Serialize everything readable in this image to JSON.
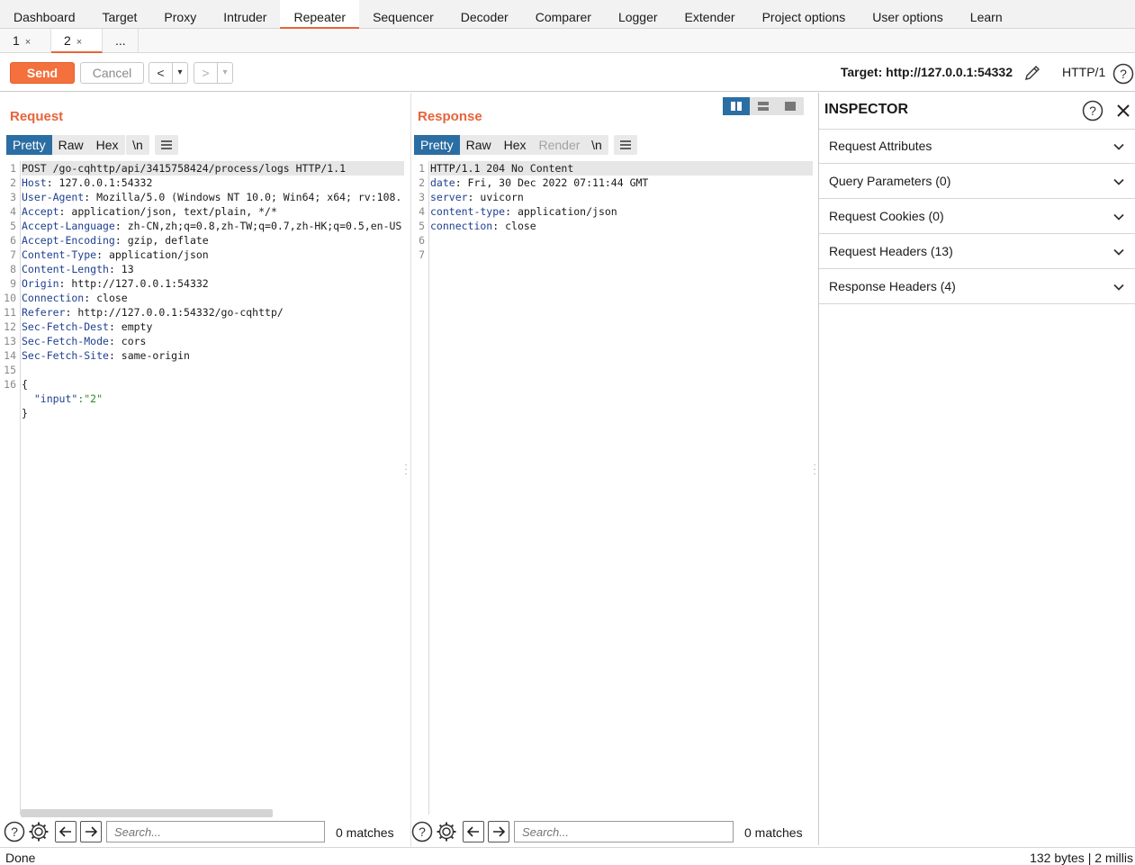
{
  "top_tabs": [
    "Dashboard",
    "Target",
    "Proxy",
    "Intruder",
    "Repeater",
    "Sequencer",
    "Decoder",
    "Comparer",
    "Logger",
    "Extender",
    "Project options",
    "User options",
    "Learn"
  ],
  "active_top_tab": "Repeater",
  "sub_tabs": [
    {
      "label": "1",
      "close": "×"
    },
    {
      "label": "2",
      "close": "×"
    },
    {
      "label": "..."
    }
  ],
  "toolbar": {
    "send_label": "Send",
    "cancel_label": "Cancel",
    "back": "<",
    "forward": ">",
    "dropdown": "▾",
    "target": "Target: http://127.0.0.1:54332",
    "http_version": "HTTP/1"
  },
  "request": {
    "title": "Request",
    "view_tabs": [
      "Pretty",
      "Raw",
      "Hex"
    ],
    "newline_btn": "\\n",
    "lines": [
      {
        "num": "1",
        "key": "",
        "value": "POST /go-cqhttp/api/3415758424/process/logs HTTP/1.1"
      },
      {
        "num": "2",
        "key": "Host",
        "value": ": 127.0.0.1:54332"
      },
      {
        "num": "3",
        "key": "User-Agent",
        "value": ": Mozilla/5.0 (Windows NT 10.0; Win64; x64; rv:108."
      },
      {
        "num": "4",
        "key": "Accept",
        "value": ": application/json, text/plain, */*"
      },
      {
        "num": "5",
        "key": "Accept-Language",
        "value": ": zh-CN,zh;q=0.8,zh-TW;q=0.7,zh-HK;q=0.5,en-US"
      },
      {
        "num": "6",
        "key": "Accept-Encoding",
        "value": ": gzip, deflate"
      },
      {
        "num": "7",
        "key": "Content-Type",
        "value": ": application/json"
      },
      {
        "num": "8",
        "key": "Content-Length",
        "value": ": 13"
      },
      {
        "num": "9",
        "key": "Origin",
        "value": ": http://127.0.0.1:54332"
      },
      {
        "num": "10",
        "key": "Connection",
        "value": ": close"
      },
      {
        "num": "11",
        "key": "Referer",
        "value": ": http://127.0.0.1:54332/go-cqhttp/"
      },
      {
        "num": "12",
        "key": "Sec-Fetch-Dest",
        "value": ": empty"
      },
      {
        "num": "13",
        "key": "Sec-Fetch-Mode",
        "value": ": cors"
      },
      {
        "num": "14",
        "key": "Sec-Fetch-Site",
        "value": ": same-origin"
      },
      {
        "num": "15",
        "key": "",
        "value": ""
      },
      {
        "num": "16",
        "key": "",
        "value": "{"
      },
      {
        "num": "",
        "key": "  \"input\"",
        "value": ":\"2\""
      },
      {
        "num": "",
        "key": "",
        "value": "}"
      }
    ]
  },
  "response": {
    "title": "Response",
    "view_tabs": [
      "Pretty",
      "Raw",
      "Hex",
      "Render"
    ],
    "newline_btn": "\\n",
    "lines": [
      {
        "num": "1",
        "key": "",
        "value": "HTTP/1.1 204 No Content"
      },
      {
        "num": "2",
        "key": "date",
        "value": ": Fri, 30 Dec 2022 07:11:44 GMT"
      },
      {
        "num": "3",
        "key": "server",
        "value": ": uvicorn"
      },
      {
        "num": "4",
        "key": "content-type",
        "value": ": application/json"
      },
      {
        "num": "5",
        "key": "connection",
        "value": ": close"
      },
      {
        "num": "6",
        "key": "",
        "value": ""
      },
      {
        "num": "7",
        "key": "",
        "value": ""
      }
    ]
  },
  "inspector": {
    "title": "INSPECTOR",
    "sections": [
      "Request Attributes",
      "Query Parameters (0)",
      "Request Cookies (0)",
      "Request Headers (13)",
      "Response Headers (4)"
    ]
  },
  "search": {
    "placeholder": "Search...",
    "request_matches": "0 matches",
    "response_matches": "0 matches"
  },
  "status": {
    "left": "Done",
    "right": "132 bytes | 2 millis"
  },
  "colors": {
    "accent": "#e8643a",
    "send": "#f4703c",
    "tab_active": "#2b6ea3",
    "header_key": "#1f3f8f"
  }
}
